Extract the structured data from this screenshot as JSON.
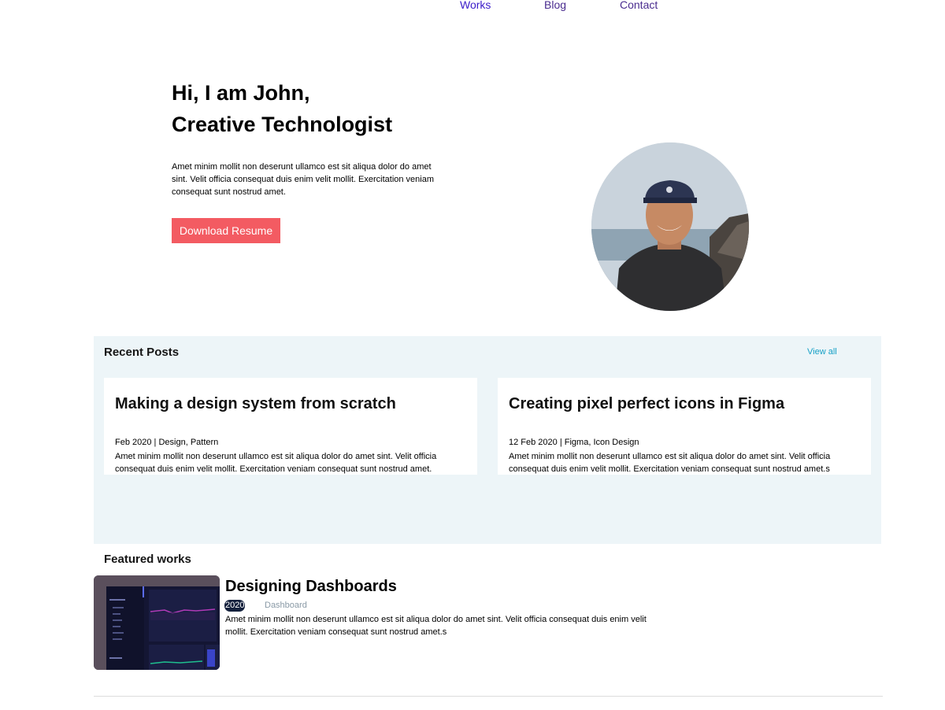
{
  "nav": {
    "items": [
      "Works",
      "Blog",
      "Contact"
    ]
  },
  "hero": {
    "title_line1": "Hi, I am John,",
    "title_line2": "Creative Technologist",
    "description": "Amet minim mollit non deserunt ullamco est sit aliqua dolor do amet sint. Velit officia consequat duis enim velit mollit. Exercitation veniam consequat sunt nostrud amet.",
    "button_label": "Download Resume"
  },
  "recent_posts": {
    "heading": "Recent Posts",
    "view_all": "View all",
    "posts": [
      {
        "title": "Making a design system from scratch",
        "date": "Feb 2020",
        "tags": "Design, Pattern",
        "excerpt": "Amet minim mollit non deserunt ullamco est sit aliqua dolor do amet sint. Velit officia consequat duis enim velit mollit. Exercitation veniam consequat sunt nostrud amet."
      },
      {
        "title": "Creating pixel perfect icons in Figma",
        "date": "12 Feb 2020",
        "tags": "Figma, Icon Design",
        "excerpt": "Amet minim mollit non deserunt ullamco est sit aliqua dolor do amet sint. Velit officia consequat duis enim velit mollit. Exercitation veniam consequat sunt nostrud amet.s"
      }
    ]
  },
  "featured": {
    "heading": "Featured works",
    "items": [
      {
        "title": "Designing Dashboards",
        "year": "2020",
        "tag": "Dashboard",
        "description": "Amet minim mollit non deserunt ullamco est sit aliqua dolor do amet sint. Velit officia consequat duis enim velit mollit. Exercitation veniam consequat sunt nostrud amet.s"
      }
    ]
  },
  "colors": {
    "accent": "#f35b62",
    "posts_background": "#edf5f8",
    "link": "#15a0c6",
    "year_badge": "#14213d"
  }
}
